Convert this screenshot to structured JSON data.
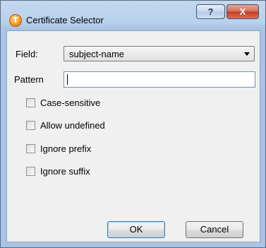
{
  "window": {
    "title": "Certificate Selector",
    "help_glyph": "?",
    "close_glyph": "X",
    "app_icon_glyph": "T"
  },
  "form": {
    "field_label": "Field:",
    "field_value": "subject-name",
    "pattern_label": "Pattern",
    "pattern_value": ""
  },
  "options": [
    {
      "label": "Case-sensitive",
      "checked": false
    },
    {
      "label": "Allow undefined",
      "checked": false
    },
    {
      "label": "Ignore prefix",
      "checked": false
    },
    {
      "label": "Ignore suffix",
      "checked": false
    }
  ],
  "buttons": {
    "ok": "OK",
    "cancel": "Cancel"
  },
  "icons": {
    "app": "certificate-app-icon",
    "help": "help-icon",
    "close": "close-icon",
    "dropdown": "chevron-down-icon"
  },
  "colors": {
    "close_button": "#c2391c",
    "frame": "#b9d1ec",
    "dialog_bg": "#f0f0f0"
  }
}
